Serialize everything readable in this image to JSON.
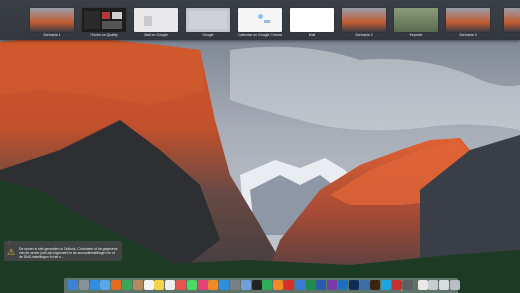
{
  "spaces": [
    {
      "label": "Scrivania 1",
      "name": "space-desktop-1"
    },
    {
      "label": "iTunes on Quality",
      "name": "space-itunes"
    },
    {
      "label": "Mail on Google",
      "name": "space-mail"
    },
    {
      "label": "Google",
      "name": "space-google"
    },
    {
      "label": "Calendar on Google Chrome",
      "name": "space-calendar"
    },
    {
      "label": "Mail",
      "name": "space-mail-2"
    },
    {
      "label": "Scrivania 2",
      "name": "space-desktop-2"
    },
    {
      "label": "Keynote",
      "name": "space-keynote"
    },
    {
      "label": "Scrivania 3",
      "name": "space-desktop-3"
    }
  ],
  "notification": {
    "text": "De server is niet gevonden in Outlook. Controleer of de gegevens van de server juist zijn ingevoerd in de accountinstellingen en of de DNS-instellingen in het s..."
  },
  "dock": {
    "items": [
      {
        "name": "finder-icon",
        "color": "#3b82d8"
      },
      {
        "name": "launchpad-icon",
        "color": "#8a8f98"
      },
      {
        "name": "safari-icon",
        "color": "#2f8ee0"
      },
      {
        "name": "mail-icon",
        "color": "#5aa6e8"
      },
      {
        "name": "firefox-icon",
        "color": "#e66a1f"
      },
      {
        "name": "chrome-icon",
        "color": "#3ba55c"
      },
      {
        "name": "contacts-icon",
        "color": "#b38b5d"
      },
      {
        "name": "calendar-icon",
        "color": "#f4f4f4"
      },
      {
        "name": "notes-icon",
        "color": "#f3d34a"
      },
      {
        "name": "reminders-icon",
        "color": "#eeeeee"
      },
      {
        "name": "photos-icon",
        "color": "#e8554e"
      },
      {
        "name": "messages-icon",
        "color": "#4cd964"
      },
      {
        "name": "itunes-icon",
        "color": "#e3457a"
      },
      {
        "name": "ibooks-icon",
        "color": "#f0892a"
      },
      {
        "name": "app-store-icon",
        "color": "#2f8ee0"
      },
      {
        "name": "system-preferences-icon",
        "color": "#7b7f86"
      },
      {
        "name": "preview-icon",
        "color": "#6f9fd8"
      },
      {
        "name": "terminal-icon",
        "color": "#222222"
      },
      {
        "name": "numbers-icon",
        "color": "#2fae5a"
      },
      {
        "name": "pages-icon",
        "color": "#f08a24"
      },
      {
        "name": "acrobat-icon",
        "color": "#d5302a"
      },
      {
        "name": "keynote-icon",
        "color": "#3a7bd5"
      },
      {
        "name": "excel-icon",
        "color": "#1f8a4c"
      },
      {
        "name": "word-icon",
        "color": "#2b5aa8"
      },
      {
        "name": "onenote-icon",
        "color": "#7a3aa8"
      },
      {
        "name": "outlook-icon",
        "color": "#1f6fc1"
      },
      {
        "name": "photoshop-icon",
        "color": "#0c2f59"
      },
      {
        "name": "lightroom-icon",
        "color": "#3a6ea5"
      },
      {
        "name": "illustrator-icon",
        "color": "#3b2411"
      },
      {
        "name": "skype-icon",
        "color": "#1aa6e0"
      },
      {
        "name": "filezilla-icon",
        "color": "#c83030"
      },
      {
        "name": "vmware-icon",
        "color": "#5a6066"
      },
      {
        "name": "textedit-icon",
        "color": "#e8e8e8"
      },
      {
        "name": "downloads-stack-icon",
        "color": "#c7ccd3"
      },
      {
        "name": "documents-stack-icon",
        "color": "#d9dde2"
      },
      {
        "name": "trash-icon",
        "color": "#b9bec5"
      }
    ]
  }
}
